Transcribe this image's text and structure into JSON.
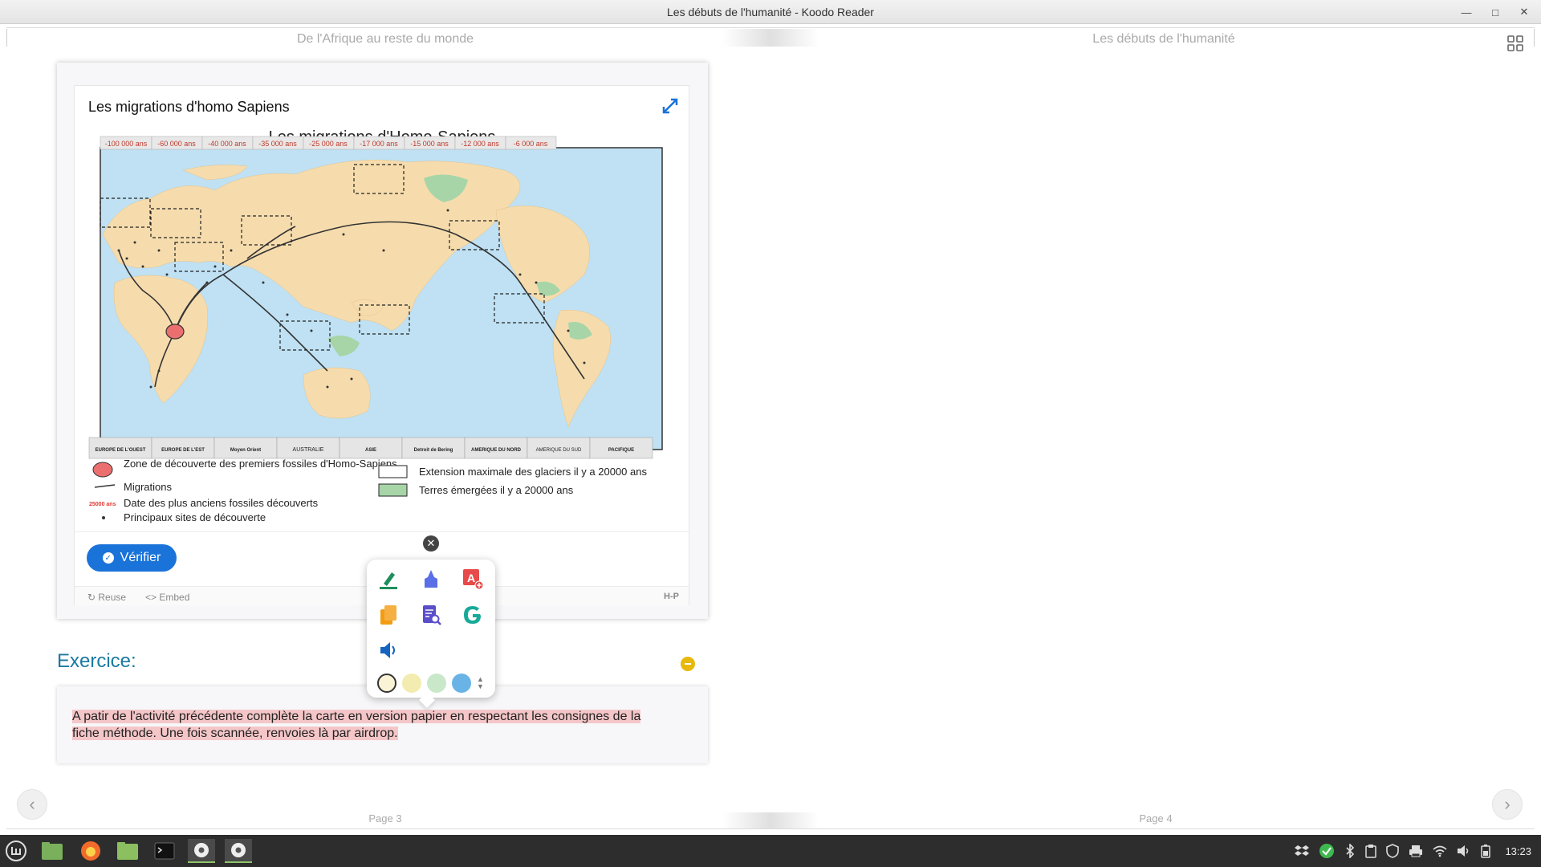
{
  "window": {
    "title": "Les débuts de l'humanité - Koodo Reader"
  },
  "reader": {
    "left_header": "De l'Afrique au reste du monde",
    "right_header": "Les débuts de l'humanité",
    "left_page": "Page 3",
    "right_page": "Page 4"
  },
  "h5p": {
    "title": "Les migrations d'homo Sapiens",
    "map": {
      "title": "Les migrations d'Homo-Sapiens",
      "dates": [
        "-100 000 ans",
        "-60 000 ans",
        "-40 000 ans",
        "-35 000 ans",
        "-25 000 ans",
        "-17 000 ans",
        "-15 000 ans",
        "-12 000 ans",
        "-6 000 ans"
      ],
      "regions": [
        "EUROPE DE L'OUEST",
        "EUROPE DE L'EST",
        "Moyen Orient",
        "AUSTRALIE",
        "ASIE",
        "Detroit de Bering",
        "AMERIQUE DU NORD",
        "AMERIQUE DU SUD",
        "PACIFIQUE"
      ],
      "legend": {
        "zone": "Zone de découverte des premiers fossiles d'Homo-Sapiens",
        "migrations": "Migrations",
        "date_sample": "25000 ans",
        "date_desc": "Date des plus anciens fossiles découverts",
        "sites": "Principaux sites de découverte",
        "glaciers": "Extension maximale des glaciers il y a 20000 ans",
        "lands": "Terres émergées il y a 20000 ans"
      }
    },
    "verify_label": "Vérifier",
    "reuse_label": "Reuse",
    "embed_label": "Embed",
    "logo": "H-P"
  },
  "exercise": {
    "title": "Exercice:",
    "line1": "A patir de l'activité précédente complète la carte en version papier en respectant les consignes de la",
    "line2": "fiche méthode. Une fois scannée, renvoies là par airdrop."
  },
  "popup": {
    "icons": [
      "highlight-pen-icon",
      "marker-icon",
      "translate-icon",
      "copy-icon",
      "search-doc-icon",
      "google-icon",
      "speaker-icon"
    ],
    "colors": [
      "#fbf3d5",
      "#f3ecb0",
      "#c9e8c9",
      "#6ab3e6"
    ]
  },
  "taskbar": {
    "clock": "13:23"
  }
}
